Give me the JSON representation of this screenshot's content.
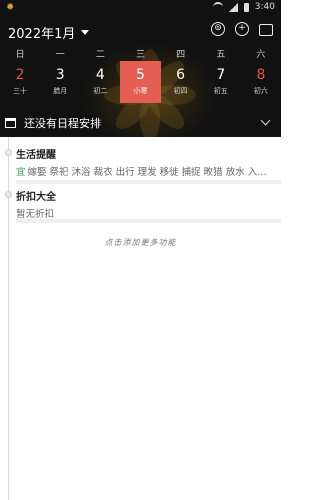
{
  "status": {
    "time": "3:40"
  },
  "header": {
    "month": "2022年1月"
  },
  "weekdays": [
    "日",
    "一",
    "二",
    "三",
    "四",
    "五",
    "六"
  ],
  "days": [
    {
      "num": "2",
      "sub": "三十"
    },
    {
      "num": "3",
      "sub": "腊月"
    },
    {
      "num": "4",
      "sub": "初二"
    },
    {
      "num": "5",
      "sub": "小寒"
    },
    {
      "num": "6",
      "sub": "初四"
    },
    {
      "num": "7",
      "sub": "初五"
    },
    {
      "num": "8",
      "sub": "初六"
    }
  ],
  "schedule": {
    "label": "还没有日程安排"
  },
  "life": {
    "title": "生活提醒",
    "yi_tag": "宜",
    "items": "嫁娶 祭祀 沐浴 裁衣 出行 理发 移徙 捕捉 畋猎 放水 入…"
  },
  "discount": {
    "title": "折扣大全",
    "empty": "暂无折扣"
  },
  "hint": "点击添加更多功能"
}
